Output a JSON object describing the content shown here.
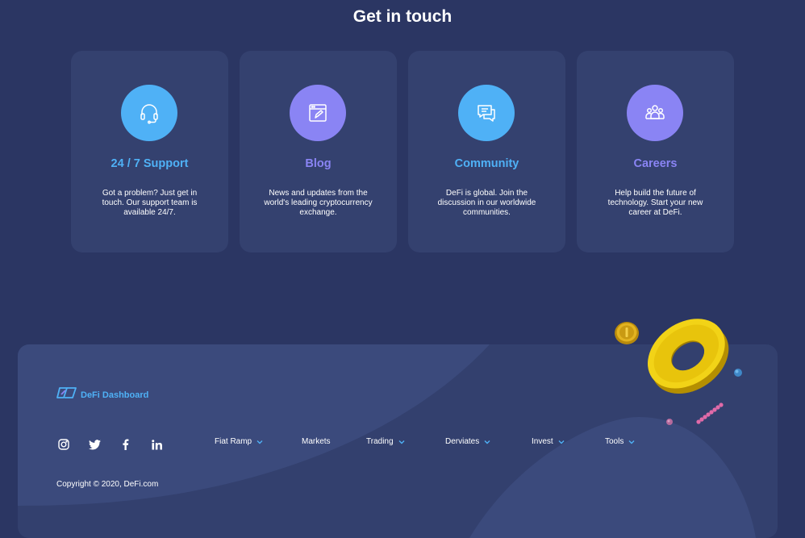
{
  "section": {
    "title": "Get in touch"
  },
  "cards": [
    {
      "title": "24 / 7 Support",
      "desc": "Got a problem? Just get in touch. Our support team is available 24/7.",
      "icon": "headset-icon",
      "color": "#4fb1f6"
    },
    {
      "title": "Blog",
      "desc": "News and updates from the world's leading cryptocurrency exchange.",
      "icon": "blog-icon",
      "color": "#8a84f4"
    },
    {
      "title": "Community",
      "desc": "DeFi is global. Join the discussion in our worldwide communities.",
      "icon": "chat-icon",
      "color": "#4fb1f6"
    },
    {
      "title": "Careers",
      "desc": "Help build the future of technology. Start your new career at DeFi.",
      "icon": "people-icon",
      "color": "#8a84f4"
    }
  ],
  "footer": {
    "logo_text": "DeFi Dashboard",
    "social": [
      "instagram-icon",
      "twitter-icon",
      "facebook-icon",
      "linkedin-icon"
    ],
    "nav": [
      {
        "label": "Fiat Ramp",
        "has_dropdown": true
      },
      {
        "label": "Markets",
        "has_dropdown": false
      },
      {
        "label": "Trading",
        "has_dropdown": true
      },
      {
        "label": "Derviates",
        "has_dropdown": true
      },
      {
        "label": "Invest",
        "has_dropdown": true
      },
      {
        "label": "Tools",
        "has_dropdown": true
      }
    ],
    "copyright": "Copyright © 2020, DeFi.com"
  },
  "colors": {
    "background": "#2b3663",
    "card": "#34416f",
    "accent_blue": "#4fb1f6",
    "accent_purple": "#8a84f4",
    "footer": "#33406e"
  }
}
